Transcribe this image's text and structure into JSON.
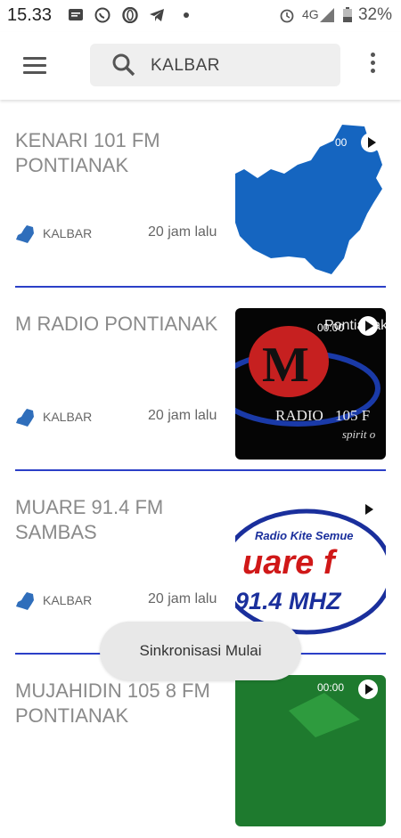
{
  "status_bar": {
    "time": "15.33",
    "network": "4G",
    "battery": "32%",
    "notif_icons": [
      "messages-icon",
      "whatsapp-icon",
      "opera-icon",
      "telegram-icon",
      "dot-icon"
    ]
  },
  "app_bar": {
    "search_text": "KALBAR"
  },
  "stations": [
    {
      "name": "KENARI 101 FM PONTIANAK",
      "region": "KALBAR",
      "time": "20 jam lalu",
      "thumb": "kalbar-map"
    },
    {
      "name": "M RADIO PONTIANAK",
      "region": "KALBAR",
      "time": "20 jam lalu",
      "thumb": "m-radio-logo",
      "thumb_text": {
        "overlay": "Pontianak",
        "overlay_time": "00:00",
        "radio": "RADIO",
        "freq": "105 F",
        "slogan": "spirit o"
      }
    },
    {
      "name": "MUARE 91.4 FM SAMBAS",
      "region": "KALBAR",
      "time": "20 jam lalu",
      "thumb": "muare-logo",
      "thumb_text": {
        "tagline": "Radio Kite Semue",
        "brand": "uare f",
        "freq": "91.4 MHZ"
      }
    },
    {
      "name": "MUJAHIDIN 105 8 FM PONTIANAK",
      "region": "KALBAR",
      "time": "",
      "thumb": "green-logo",
      "thumb_text": {
        "overlay_time": "00:00"
      }
    }
  ],
  "toast": "Sinkronisasi Mulai",
  "colors": {
    "separator": "#2b3fc7",
    "map_blue": "#1565c0"
  }
}
